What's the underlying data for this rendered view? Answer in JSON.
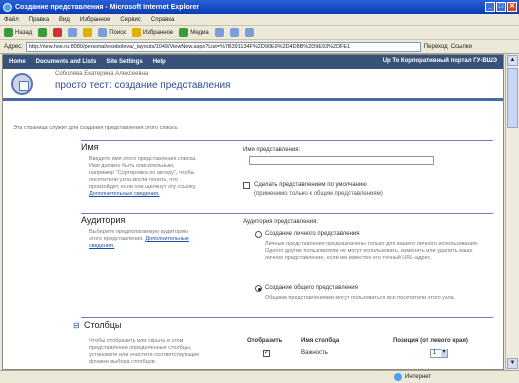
{
  "window": {
    "title": "Создание представления - Microsoft Internet Explorer",
    "buttons": [
      "_",
      "□",
      "✕"
    ]
  },
  "menu": [
    "Файл",
    "Правка",
    "Вид",
    "Избранное",
    "Сервис",
    "Справка"
  ],
  "toolbar": {
    "back": "Назад",
    "search": "Поиск",
    "favorites": "Избранное",
    "media": "Медиа"
  },
  "address": {
    "label": "Адрес:",
    "url": "http://new.hse.ru:8080/personal/esobolevа/_layouts/1049/ViewNew.aspx?List=%7B391134F%2D90E9%2D4D8B%2D9E93%2DFE1",
    "go": "Переход",
    "links": "Ссылки"
  },
  "nav": {
    "items": [
      "Home",
      "Documents and Lists",
      "Site Settings",
      "Help"
    ],
    "right": "Up To Корпоративный портал ГУ-ВШЭ"
  },
  "header": {
    "site": "Соболева Екатерина Алексеевна",
    "title_prefix": "просто тест:",
    "title_main": " создание представления"
  },
  "intro": "Эта страница служит для создания представления этого списка.",
  "sections": {
    "name": {
      "heading": "Имя",
      "description": "Введите имя этого представления списка. Имя должно быть описательным, например \"Сортировка по автору\", чтобы посетители узла могли понять, что произойдет, если они щелкнут эту ссылку.",
      "more": "Дополнительные сведения.",
      "field_label": "Имя представления:",
      "default_checkbox": "Сделать представлением по умолчанию",
      "default_note": "(применимо только к общим представлениям)"
    },
    "audience": {
      "heading": "Аудитория",
      "description": "Выберите предполагаемую аудиторию этого представления.",
      "more": "Дополнительные сведения.",
      "label": "Аудитория представления:",
      "personal": "Создание личного представления",
      "personal_note": "Личные представления предназначены только для вашего личного использования. Одного другие пользователи не могут использовать, изменять или удалить ваше личное представление, если им известен его точный URL-адрес.",
      "public": "Создание общего представления",
      "public_note": "Общими представлениями могут пользоваться все посетители этого узла."
    },
    "columns": {
      "heading": "Столбцы",
      "description": "Чтобы отобразить или скрыть в этом представлении определенные столбцы, установите или очистите соответствующие флажки выбора столбцов.",
      "col_display": "Отобразить",
      "col_name": "Имя столбца",
      "col_position": "Позиция (от левого края)",
      "rows": [
        {
          "name": "Важность",
          "position": "1"
        }
      ]
    }
  },
  "status": {
    "zone": "Интернет"
  }
}
